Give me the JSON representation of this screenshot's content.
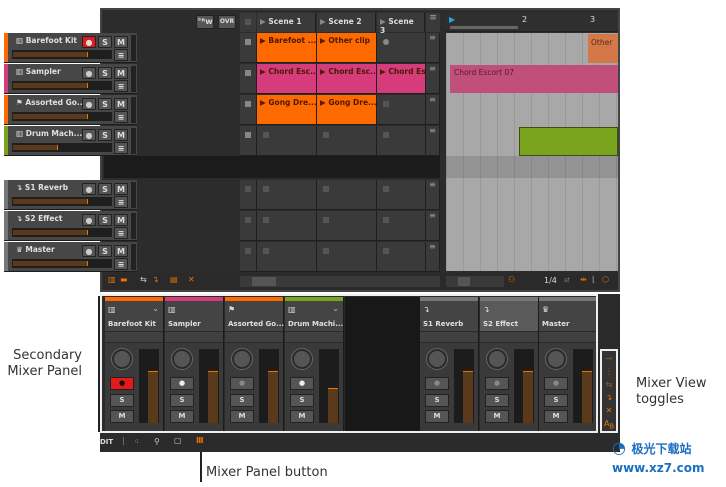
{
  "header": {
    "auto_label": "°ᴿw",
    "ovr_label": "OVR"
  },
  "scenes": [
    "Scene 1",
    "Scene 2",
    "Scene 3"
  ],
  "tracks": [
    {
      "name": "Barefoot Kit",
      "color": "#ff6a00",
      "icon": "piano-icon",
      "rec": true,
      "vol": 0.75,
      "clips": [
        "Barefoot ...",
        "Other clip",
        null
      ]
    },
    {
      "name": "Sampler",
      "color": "#d63b7c",
      "icon": "piano-icon",
      "rec": false,
      "vol": 0.75,
      "clips": [
        "Chord Esc...",
        "Chord Esc...",
        "Chord Esc"
      ]
    },
    {
      "name": "Assorted Go...",
      "color": "#ff6a00",
      "icon": "flag-icon",
      "rec": false,
      "vol": 0.75,
      "clips": [
        "Gong Dre...",
        "Gong Dre...",
        null
      ]
    },
    {
      "name": "Drum Mach...",
      "color": "#7aa31e",
      "icon": "piano-icon",
      "rec": false,
      "vol": 0.45,
      "clips": [
        null,
        null,
        null
      ]
    }
  ],
  "effects": [
    {
      "name": "S1 Reverb",
      "icon": "return-icon"
    },
    {
      "name": "S2 Effect",
      "icon": "return-icon"
    },
    {
      "name": "Master",
      "icon": "crown-icon"
    }
  ],
  "buttons": {
    "solo": "S",
    "mute": "M"
  },
  "arranger": {
    "ruler": [
      "2",
      "3"
    ],
    "clips": [
      "Other",
      "Chord Escort 07"
    ],
    "grid": "1/4",
    "grid_unit": "st"
  },
  "mixer": {
    "strips": [
      {
        "name": "Barefoot Kit",
        "color": "#ff6a00",
        "level": 0.7
      },
      {
        "name": "Sampler",
        "color": "#d63b7c",
        "level": 0.7
      },
      {
        "name": "Assorted Go...",
        "color": "#ff6a00",
        "level": 0.7
      },
      {
        "name": "Drum Machi...",
        "color": "#7aa31e",
        "level": 0.47
      },
      {
        "name": "S1 Reverb",
        "color": "#777777",
        "level": 0.7
      },
      {
        "name": "S2 Effect",
        "color": "#777777",
        "level": 0.7
      },
      {
        "name": "Master",
        "color": "#777777",
        "level": 0.7
      }
    ]
  },
  "bottombar": {
    "edit": "DIT"
  },
  "annotations": {
    "secondary": "Secondary Mixer Panel",
    "toggles": "Mixer View toggles",
    "panel_button": "Mixer Panel button"
  },
  "watermark": "极光下载站 www.xz7.com"
}
